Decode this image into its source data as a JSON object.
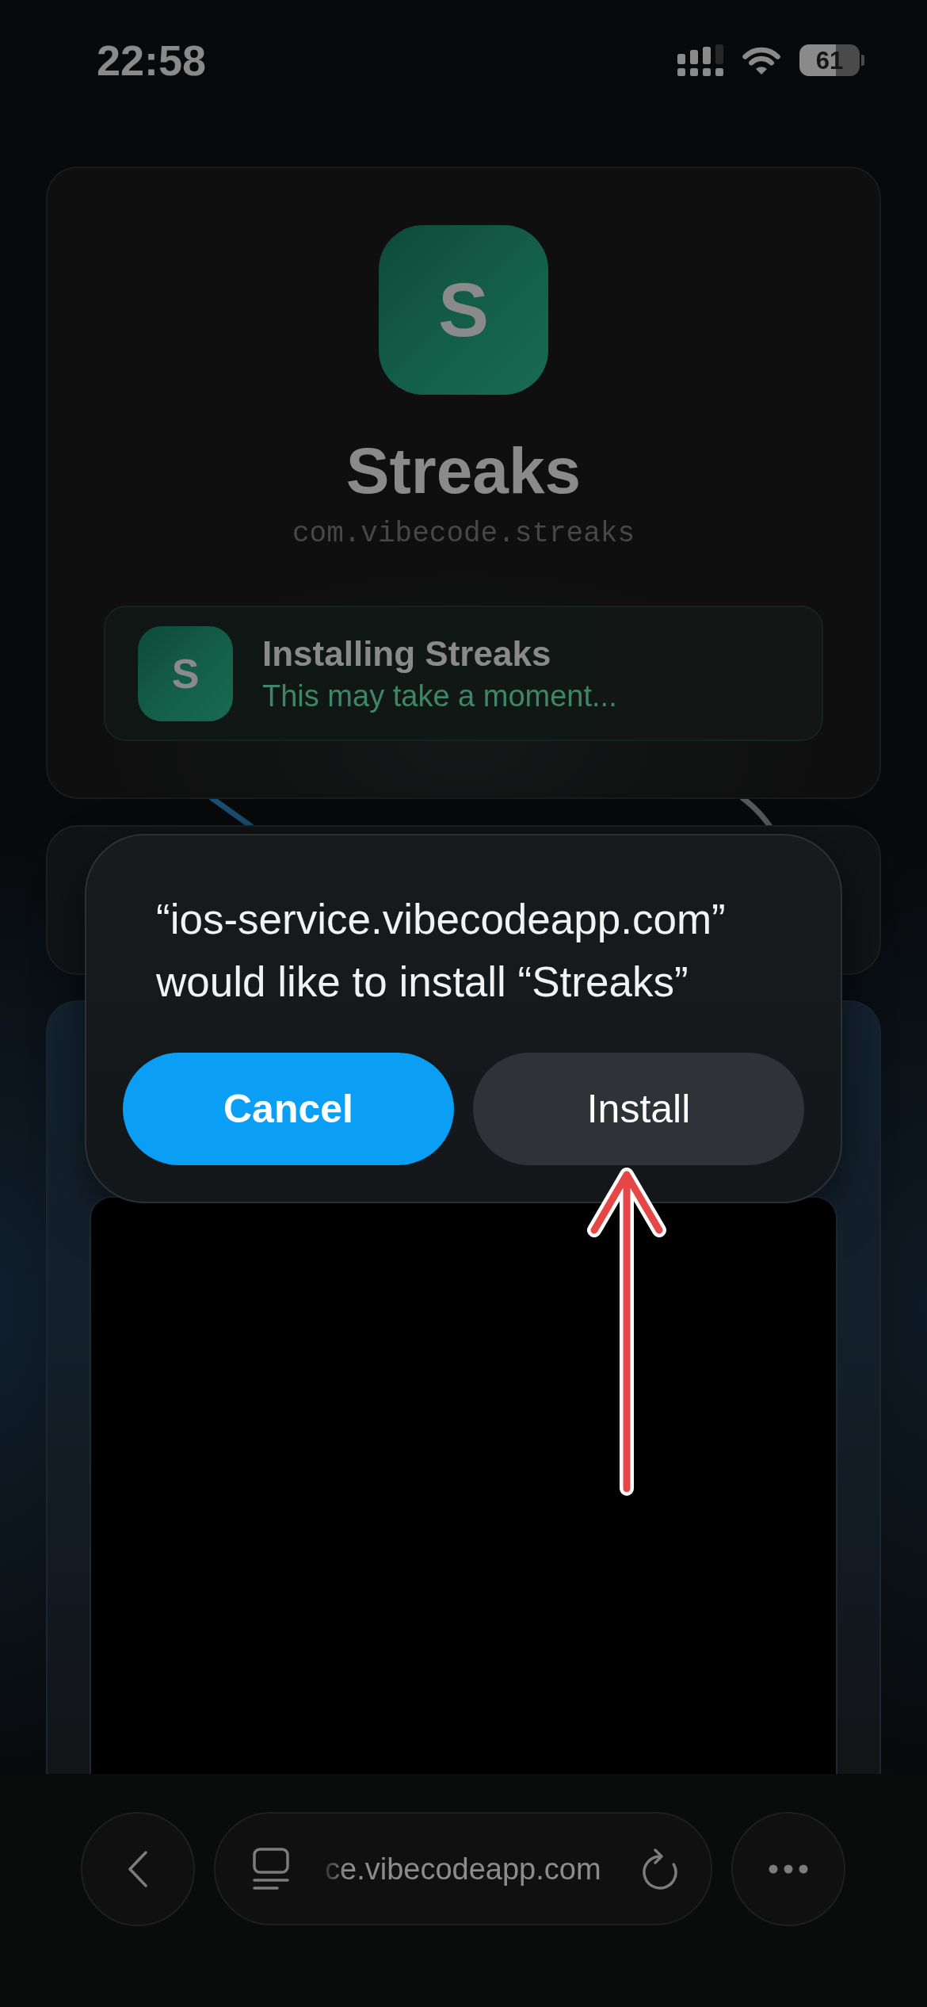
{
  "status_bar": {
    "time": "22:58",
    "battery": "61"
  },
  "app": {
    "icon_letter": "S",
    "name": "Streaks",
    "bundle_id": "com.vibecode.streaks"
  },
  "install_status": {
    "icon_letter": "S",
    "title": "Installing Streaks",
    "subtitle": "This may take a moment..."
  },
  "dialog": {
    "message": "“ios-service.vibecodeapp.com” would like to install “Streaks”",
    "buttons": [
      {
        "label": "Cancel",
        "kind": "primary"
      },
      {
        "label": "Install",
        "kind": "secondary"
      }
    ]
  },
  "browser_bar": {
    "url": "ce.vibecodeapp.com"
  }
}
